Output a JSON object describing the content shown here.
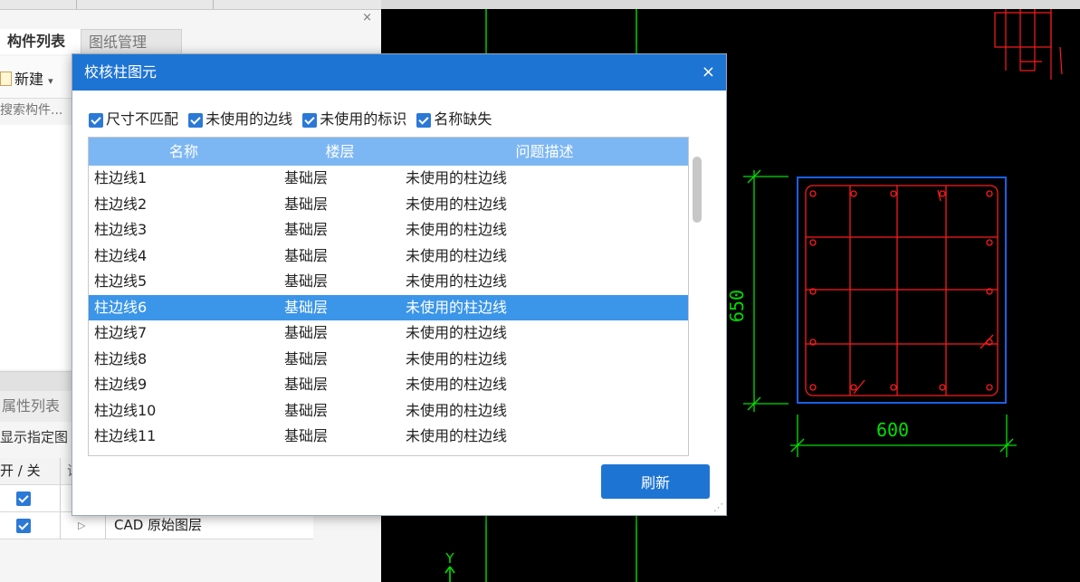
{
  "left_panel": {
    "close_glyph": "×",
    "tabs": [
      {
        "label": "构件列表"
      },
      {
        "label": "图纸管理"
      }
    ],
    "toolbar": {
      "new_label": "新建",
      "new_caret": "▾"
    },
    "search": {
      "placeholder": "搜索构件..."
    },
    "property_tab": "属性列表",
    "show_specified": "显示指定图",
    "layer_table": {
      "header": {
        "toggle": "开 / 关",
        "col2_partial": "诵"
      },
      "rows": [
        {
          "checked": true,
          "arrow": "",
          "name": ""
        },
        {
          "checked": true,
          "arrow": "▷",
          "name": "CAD 原始图层"
        }
      ]
    }
  },
  "cad": {
    "dimension_vertical": "650",
    "dimension_horizontal": "600",
    "axis_label": "Y",
    "colors": {
      "background": "#000000",
      "rebar": "#ff1a1a",
      "outline": "#1a6cff",
      "dimension": "#00e000"
    }
  },
  "dialog": {
    "title": "校核柱图元",
    "close_glyph": "×",
    "filters": [
      {
        "label": "尺寸不匹配",
        "checked": true
      },
      {
        "label": "未使用的边线",
        "checked": true
      },
      {
        "label": "未使用的标识",
        "checked": true
      },
      {
        "label": "名称缺失",
        "checked": true
      }
    ],
    "columns": [
      "名称",
      "楼层",
      "问题描述"
    ],
    "rows": [
      {
        "name": "柱边线1",
        "floor": "基础层",
        "desc": "未使用的柱边线"
      },
      {
        "name": "柱边线2",
        "floor": "基础层",
        "desc": "未使用的柱边线"
      },
      {
        "name": "柱边线3",
        "floor": "基础层",
        "desc": "未使用的柱边线"
      },
      {
        "name": "柱边线4",
        "floor": "基础层",
        "desc": "未使用的柱边线"
      },
      {
        "name": "柱边线5",
        "floor": "基础层",
        "desc": "未使用的柱边线"
      },
      {
        "name": "柱边线6",
        "floor": "基础层",
        "desc": "未使用的柱边线",
        "selected": true
      },
      {
        "name": "柱边线7",
        "floor": "基础层",
        "desc": "未使用的柱边线"
      },
      {
        "name": "柱边线8",
        "floor": "基础层",
        "desc": "未使用的柱边线"
      },
      {
        "name": "柱边线9",
        "floor": "基础层",
        "desc": "未使用的柱边线"
      },
      {
        "name": "柱边线10",
        "floor": "基础层",
        "desc": "未使用的柱边线"
      },
      {
        "name": "柱边线11",
        "floor": "基础层",
        "desc": "未使用的柱边线"
      }
    ],
    "refresh_label": "刷新",
    "accent": "#1e74d3",
    "selected_row_color": "#3b95e8"
  }
}
